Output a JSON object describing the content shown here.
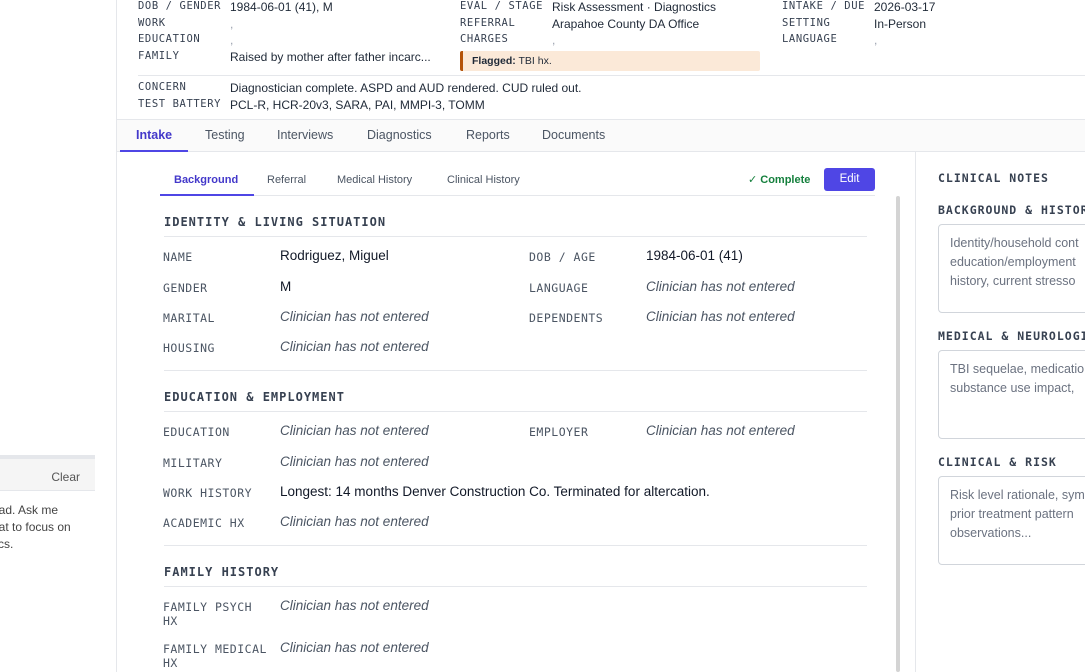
{
  "left_panel": {
    "clear_label": "Clear",
    "message_lines": [
      "oad. Ask me",
      "hat to focus on",
      "tics."
    ]
  },
  "header": {
    "fields": [
      {
        "label": "DOB / GENDER",
        "value": "1984-06-01 (41), M"
      },
      {
        "label": "WORK",
        "value": ","
      },
      {
        "label": "EDUCATION",
        "value": ","
      },
      {
        "label": "FAMILY",
        "value": "Raised by mother after father incarc..."
      },
      {
        "label": "EVAL / STAGE",
        "value": "Risk Assessment · Diagnostics"
      },
      {
        "label": "REFERRAL",
        "value": "Arapahoe County DA Office"
      },
      {
        "label": "CHARGES",
        "value": ","
      },
      {
        "label": "INTAKE / DUE",
        "value": "2026-03-17"
      },
      {
        "label": "SETTING",
        "value": "In-Person"
      },
      {
        "label": "LANGUAGE",
        "value": ","
      },
      {
        "label": "CONCERN",
        "value": "Diagnostician complete. ASPD and AUD rendered. CUD ruled out."
      },
      {
        "label": "TEST BATTERY",
        "value": "PCL-R, HCR-20v3, SARA, PAI, MMPI-3, TOMM"
      }
    ],
    "flag": {
      "prefix": "Flagged:",
      "text": "TBI hx."
    }
  },
  "main_tabs": [
    "Intake",
    "Testing",
    "Interviews",
    "Diagnostics",
    "Reports",
    "Documents"
  ],
  "sub_tabs": [
    "Background",
    "Referral",
    "Medical History",
    "Clinical History"
  ],
  "status": {
    "complete_label": "✓ Complete",
    "edit_label": "Edit",
    "complete_color": "#15803d",
    "accent": "#4f46e5"
  },
  "sections": [
    {
      "title": "IDENTITY & LIVING SITUATION"
    },
    {
      "title": "EDUCATION & EMPLOYMENT"
    },
    {
      "title": "FAMILY HISTORY"
    }
  ],
  "fields": {
    "name": {
      "label": "NAME",
      "value": "Rodriguez, Miguel"
    },
    "dob_age": {
      "label": "DOB / AGE",
      "value": "1984-06-01 (41)"
    },
    "gender": {
      "label": "GENDER",
      "value": "M"
    },
    "language": {
      "label": "LANGUAGE",
      "value": "Clinician has not entered"
    },
    "marital": {
      "label": "MARITAL",
      "value": "Clinician has not entered"
    },
    "dependents": {
      "label": "DEPENDENTS",
      "value": "Clinician has not entered"
    },
    "housing": {
      "label": "HOUSING",
      "value": "Clinician has not entered"
    },
    "education": {
      "label": "EDUCATION",
      "value": "Clinician has not entered"
    },
    "employer": {
      "label": "EMPLOYER",
      "value": "Clinician has not entered"
    },
    "military": {
      "label": "MILITARY",
      "value": "Clinician has not entered"
    },
    "work_history": {
      "label": "WORK HISTORY",
      "value": "Longest: 14 months Denver Construction Co. Terminated for altercation."
    },
    "academic_hx": {
      "label": "ACADEMIC HX",
      "value": "Clinician has not entered"
    },
    "family_psych_hx": {
      "label_line1": "FAMILY PSYCH",
      "label_line2": "HX",
      "value": "Clinician has not entered"
    },
    "family_medical_hx": {
      "label_line1": "FAMILY MEDICAL",
      "label_line2": "HX",
      "value": "Clinician has not entered"
    }
  },
  "notes": {
    "title": "CLINICAL NOTES",
    "sections": [
      {
        "title": "BACKGROUND & HISTORY",
        "placeholder_lines": [
          "Identity/household cont",
          "education/employment",
          "history, current stresso"
        ]
      },
      {
        "title": "MEDICAL & NEUROLOGIC",
        "placeholder_lines": [
          "TBI sequelae, medicatio",
          "substance use impact,"
        ]
      },
      {
        "title": "CLINICAL & RISK",
        "placeholder_lines": [
          "Risk level rationale, sym",
          "prior treatment pattern",
          "observations..."
        ]
      }
    ]
  }
}
